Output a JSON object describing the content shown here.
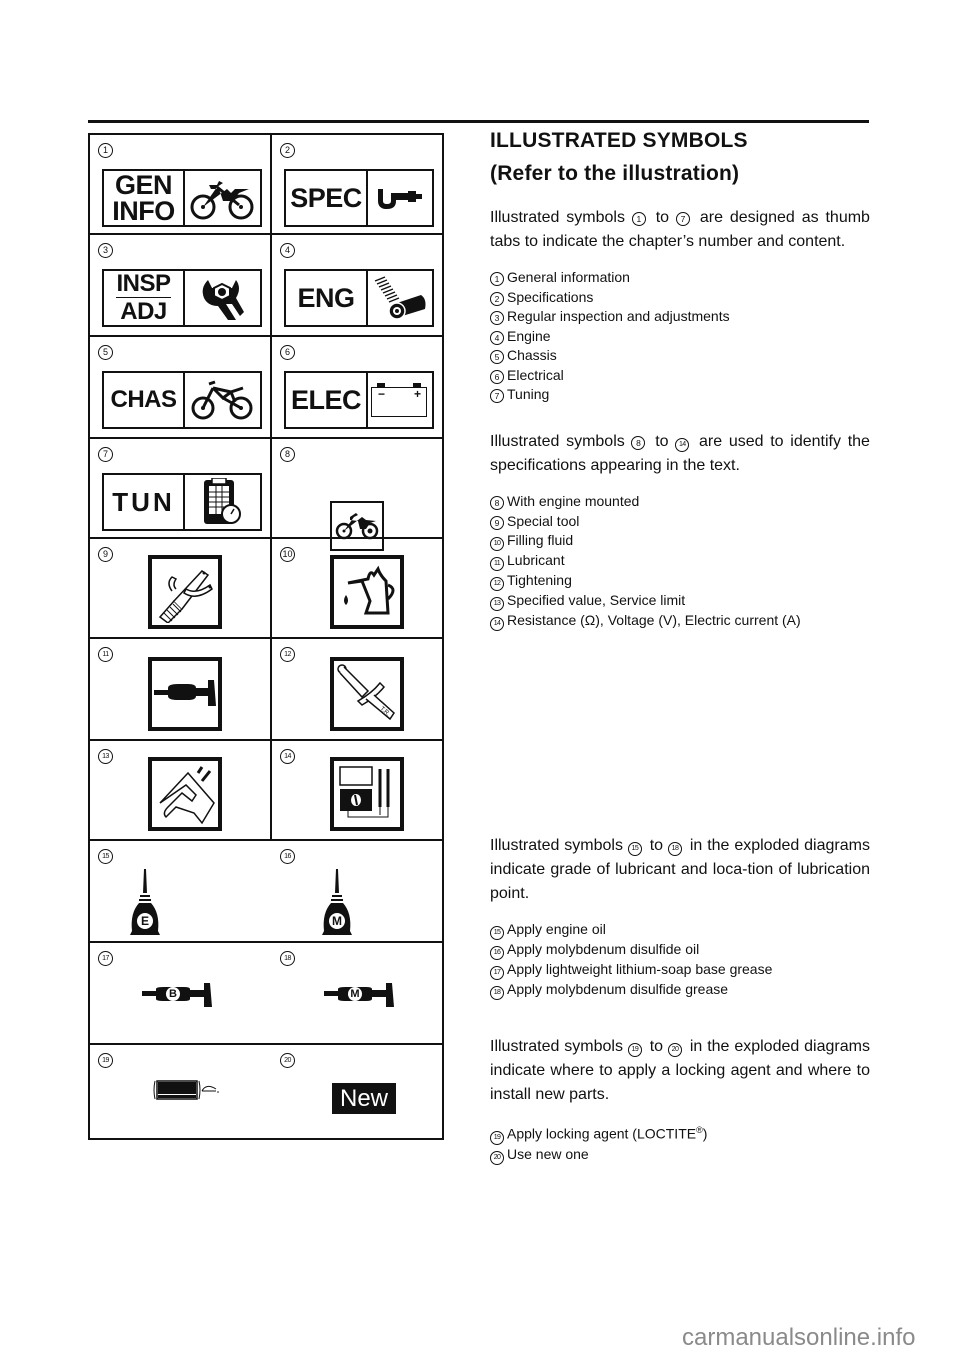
{
  "heading": {
    "title": "ILLUSTRATED SYMBOLS",
    "subtitle": "(Refer to the illustration)"
  },
  "section1": {
    "intro": [
      "Illustrated symbols",
      "1",
      "to",
      "7",
      "are designed as thumb tabs to indicate the chapter’s number and content."
    ],
    "items": [
      {
        "num": "1",
        "label": "General information"
      },
      {
        "num": "2",
        "label": "Specifications"
      },
      {
        "num": "3",
        "label": "Regular inspection and adjustments"
      },
      {
        "num": "4",
        "label": "Engine"
      },
      {
        "num": "5",
        "label": "Chassis"
      },
      {
        "num": "6",
        "label": "Electrical"
      },
      {
        "num": "7",
        "label": "Tuning"
      }
    ]
  },
  "section2": {
    "intro": [
      "Illustrated symbols",
      "8",
      "to",
      "14",
      "are used to identify the specifications appearing in the text."
    ],
    "items": [
      {
        "num": "8",
        "label": "With engine mounted"
      },
      {
        "num": "9",
        "label": "Special tool"
      },
      {
        "num": "10",
        "label": "Filling fluid"
      },
      {
        "num": "11",
        "label": "Lubricant"
      },
      {
        "num": "12",
        "label": "Tightening"
      },
      {
        "num": "13",
        "label": "Specified value, Service limit"
      },
      {
        "num": "14",
        "label": "Resistance (Ω), Voltage (V), Electric current (A)"
      }
    ]
  },
  "section3": {
    "intro": [
      "Illustrated symbols",
      "15",
      "to",
      "18",
      "in the exploded diagrams indicate grade of lubricant and loca-tion of lubrication point."
    ],
    "items": [
      {
        "num": "15",
        "label": "Apply engine oil"
      },
      {
        "num": "16",
        "label": "Apply molybdenum disulfide oil"
      },
      {
        "num": "17",
        "label": "Apply lightweight lithium-soap base grease"
      },
      {
        "num": "18",
        "label": "Apply molybdenum disulfide grease"
      }
    ]
  },
  "section4": {
    "intro": [
      "Illustrated symbols",
      "19",
      "to",
      "20",
      "in the exploded diagrams indicate where to apply a locking agent and where to install new parts."
    ],
    "items": [
      {
        "num": "19",
        "label": "Apply locking agent (LOCTITE",
        "sup": "®",
        "tail": ")"
      },
      {
        "num": "20",
        "label": "Use new one"
      }
    ]
  },
  "symbols": {
    "tabs": {
      "gen_top": "GEN",
      "gen_bottom": "INFO",
      "spec": "SPEC",
      "insp": "INSP",
      "adj": "ADJ",
      "eng": "ENG",
      "chas": "CHAS",
      "elec": "ELEC",
      "tun": "TUN"
    },
    "battery_minus": "−",
    "battery_plus": "+",
    "oil_e": "E",
    "oil_m": "M",
    "grease_b": "B",
    "grease_m": "M",
    "new_badge": "New",
    "numbers": [
      "1",
      "2",
      "3",
      "4",
      "5",
      "6",
      "7",
      "8",
      "9",
      "10",
      "11",
      "12",
      "13",
      "14",
      "15",
      "16",
      "17",
      "18",
      "19",
      "20"
    ]
  },
  "watermark": "carmanualsonline.info"
}
